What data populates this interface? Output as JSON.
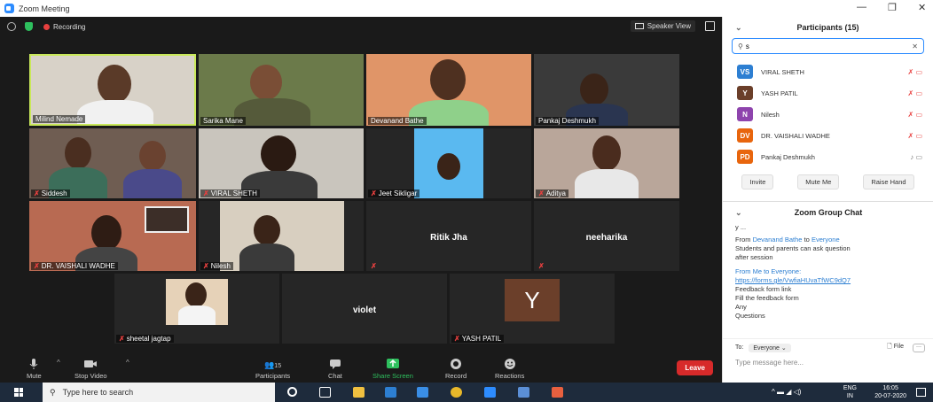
{
  "window": {
    "title": "Zoom Meeting"
  },
  "topbar": {
    "recording": "Recording",
    "speaker_view": "Speaker View"
  },
  "tiles": [
    {
      "name": "Milind Nemade",
      "muted": false
    },
    {
      "name": "Sarika Mane",
      "muted": false
    },
    {
      "name": "Devanand Bathe",
      "muted": false
    },
    {
      "name": "Pankaj Deshmukh",
      "muted": false
    },
    {
      "name": "Siddesh",
      "muted": true
    },
    {
      "name": "VIRAL SHETH",
      "muted": true
    },
    {
      "name": "Jeet Sikligar",
      "muted": true
    },
    {
      "name": "Aditya",
      "muted": true
    },
    {
      "name": "DR. VAISHALI WADHE",
      "muted": true
    },
    {
      "name": "Nilesh",
      "muted": true
    },
    {
      "name": "Ritik Jha",
      "muted": true
    },
    {
      "name": "neeharika",
      "muted": true
    },
    {
      "name": "sheetal jagtap",
      "muted": true
    },
    {
      "name": "violet",
      "muted": false
    },
    {
      "name": "YASH PATIL",
      "muted": true,
      "avatar_letter": "Y"
    }
  ],
  "toolbar": {
    "mute": "Mute",
    "stop_video": "Stop Video",
    "participants": "Participants",
    "participants_count": "15",
    "chat": "Chat",
    "share_screen": "Share Screen",
    "record": "Record",
    "reactions": "Reactions",
    "leave": "Leave"
  },
  "participants_panel": {
    "title": "Participants (15)",
    "search_value": "s",
    "list": [
      {
        "initials": "VS",
        "name": "VIRAL SHETH",
        "color": "#2d7fd2"
      },
      {
        "initials": "Y",
        "name": "YASH PATIL",
        "color": "#6b3f2a"
      },
      {
        "initials": "N",
        "name": "Nilesh",
        "color": "#8e44ad"
      },
      {
        "initials": "DV",
        "name": "DR. VAISHALI WADHE",
        "color": "#e8650d"
      },
      {
        "initials": "PD",
        "name": "Pankaj Deshmukh",
        "color": "#e8650d"
      }
    ],
    "buttons": {
      "invite": "Invite",
      "mute_me": "Mute Me",
      "raise_hand": "Raise Hand"
    }
  },
  "chat_panel": {
    "title": "Zoom Group Chat",
    "partial": "y ...",
    "msg1_from": "Devanand Bathe",
    "msg1_to": "Everyone",
    "msg1_from_prefix": "From",
    "msg1_to_prefix": "to",
    "msg1_lines": [
      "Students and parents can ask question",
      "after session"
    ],
    "msg2_header": "From Me to Everyone:",
    "msg2_link": "https://forms.gle/VwfiaHUvaTfWC9dQ7",
    "msg2_lines": [
      "Feedback form link",
      "Fill the feedback form",
      "Any",
      "Questions"
    ],
    "to_label": "To:",
    "to_value": "Everyone",
    "file": "File",
    "input_placeholder": "Type message here..."
  },
  "taskbar": {
    "search_placeholder": "Type here to search",
    "lang": "ENG",
    "region": "IN",
    "time": "16:05",
    "date": "20-07-2020"
  },
  "colors": {
    "accent": "#2d8cff",
    "leave": "#d72a2a",
    "mute": "#e8403f",
    "active_speaker": "#c9e85a"
  }
}
